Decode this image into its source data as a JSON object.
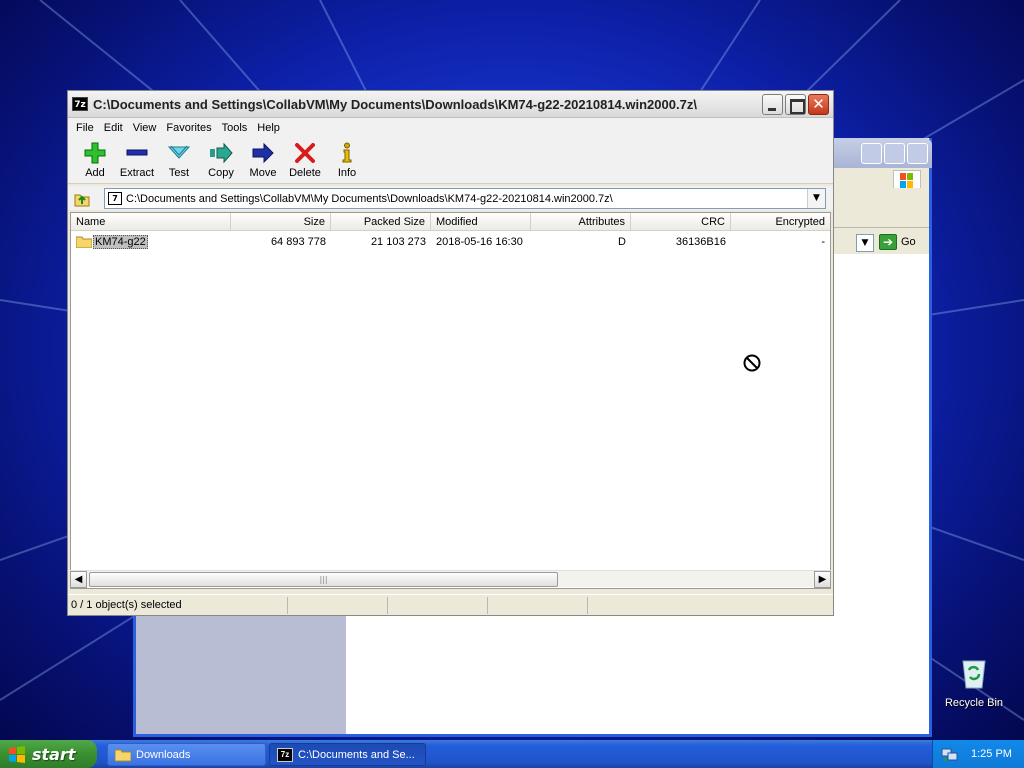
{
  "window": {
    "title": "C:\\Documents and Settings\\CollabVM\\My Documents\\Downloads\\KM74-g22-20210814.win2000.7z\\",
    "app_icon_text": "7z",
    "close_glyph": "✕"
  },
  "menu": [
    "File",
    "Edit",
    "View",
    "Favorites",
    "Tools",
    "Help"
  ],
  "toolbar": [
    {
      "label": "Add",
      "icon": "add-icon"
    },
    {
      "label": "Extract",
      "icon": "extract-icon"
    },
    {
      "label": "Test",
      "icon": "test-icon"
    },
    {
      "label": "Copy",
      "icon": "copy-icon"
    },
    {
      "label": "Move",
      "icon": "move-icon"
    },
    {
      "label": "Delete",
      "icon": "delete-icon"
    },
    {
      "label": "Info",
      "icon": "info-icon"
    }
  ],
  "address": {
    "value": "C:\\Documents and Settings\\CollabVM\\My Documents\\Downloads\\KM74-g22-20210814.win2000.7z\\"
  },
  "columns": [
    "Name",
    "Size",
    "Packed Size",
    "Modified",
    "Attributes",
    "CRC",
    "Encrypted"
  ],
  "rows": [
    {
      "name": "KM74-g22",
      "size": "64 893 778",
      "packed_size": "21 103 273",
      "modified": "2018-05-16 16:30",
      "attributes": "D",
      "crc": "36136B16",
      "encrypted": "-"
    }
  ],
  "status": {
    "selection": "0 / 1 object(s) selected"
  },
  "background_window": {
    "go_label": "Go"
  },
  "desktop": {
    "recycle_bin_label": "Recycle Bin"
  },
  "taskbar": {
    "start_label": "start",
    "tasks": [
      {
        "label": "Downloads",
        "icon": "folder-icon"
      },
      {
        "label": "C:\\Documents and Se...",
        "icon": "7zip-icon"
      }
    ],
    "clock": "1:25 PM"
  }
}
